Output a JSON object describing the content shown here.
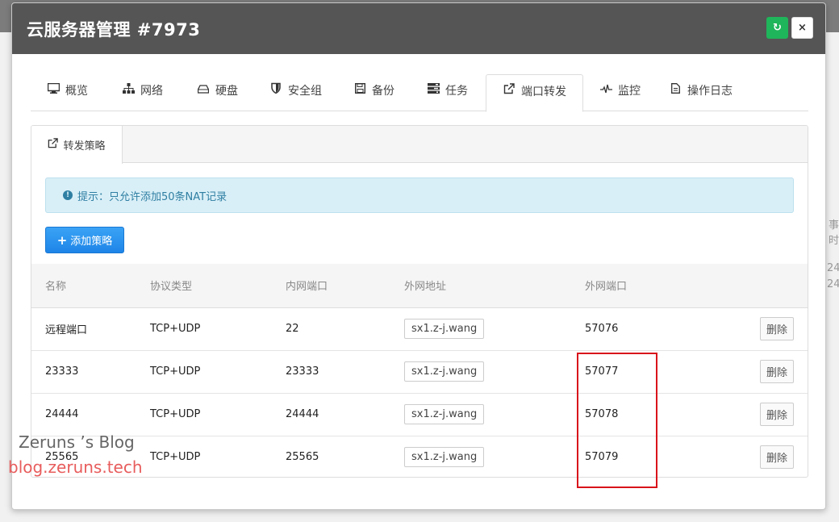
{
  "background": {
    "side_text_1": "事时",
    "side_text_2": "24",
    "side_text_3": "24"
  },
  "modal": {
    "title": "云服务器管理 #7973",
    "refresh_icon": "refresh-icon",
    "close_symbol": "×"
  },
  "tabs": [
    {
      "label": "概览",
      "icon": "monitor-icon"
    },
    {
      "label": "网络",
      "icon": "network-icon"
    },
    {
      "label": "硬盘",
      "icon": "disk-icon"
    },
    {
      "label": "安全组",
      "icon": "shield-icon"
    },
    {
      "label": "备份",
      "icon": "save-icon"
    },
    {
      "label": "任务",
      "icon": "tasks-icon"
    },
    {
      "label": "端口转发",
      "icon": "external-link-icon",
      "active": true
    },
    {
      "label": "监控",
      "icon": "pulse-icon"
    },
    {
      "label": "操作日志",
      "icon": "file-icon"
    }
  ],
  "panel": {
    "tab_label": "转发策略",
    "alert_text": "提示：只允许添加50条NAT记录",
    "add_button": "添加策略",
    "columns": [
      "名称",
      "协议类型",
      "内网端口",
      "外网地址",
      "外网端口",
      ""
    ],
    "rows": [
      {
        "name": "远程端口",
        "protocol": "TCP+UDP",
        "internal_port": "22",
        "external_address": "sx1.z-j.wang",
        "external_port": "57076",
        "action": "删除"
      },
      {
        "name": "23333",
        "protocol": "TCP+UDP",
        "internal_port": "23333",
        "external_address": "sx1.z-j.wang",
        "external_port": "57077",
        "action": "删除"
      },
      {
        "name": "24444",
        "protocol": "TCP+UDP",
        "internal_port": "24444",
        "external_address": "sx1.z-j.wang",
        "external_port": "57078",
        "action": "删除"
      },
      {
        "name": "25565",
        "protocol": "TCP+UDP",
        "internal_port": "25565",
        "external_address": "sx1.z-j.wang",
        "external_port": "57079",
        "action": "删除"
      }
    ]
  },
  "watermark": {
    "line1": "Zeruns ’s Blog",
    "line2": "blog.zeruns.tech"
  },
  "colors": {
    "header": "#555555",
    "refresh_button": "#1fb55a",
    "add_button": "#1e85e8",
    "alert_bg": "#d9eff7",
    "highlight": "#d9141b"
  }
}
